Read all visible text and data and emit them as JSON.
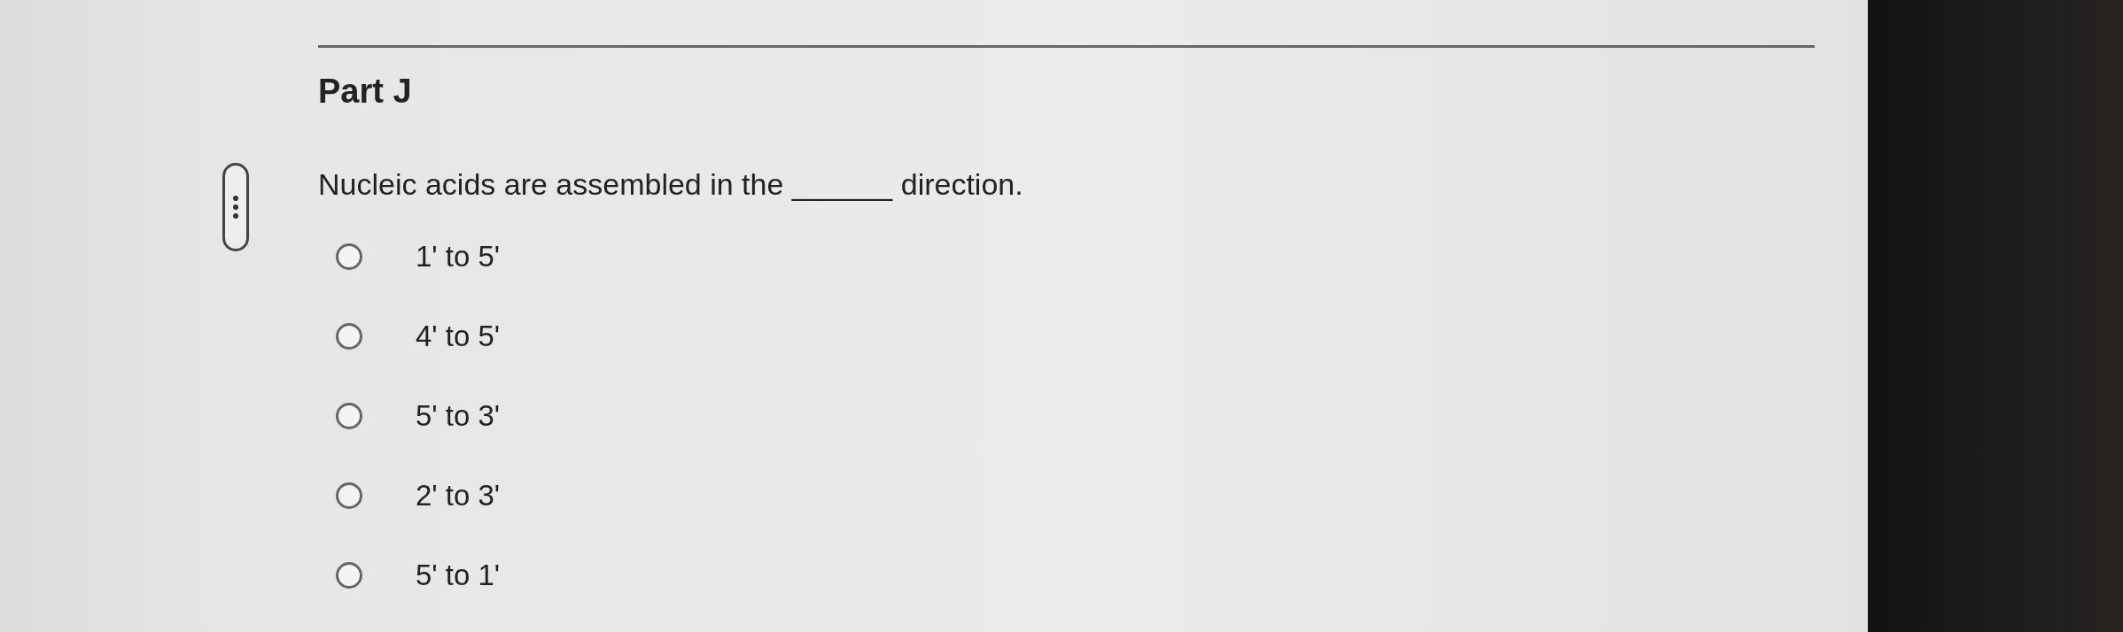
{
  "part_title": "Part J",
  "question": "Nucleic acids are assembled in the ______ direction.",
  "options": [
    {
      "label": "1' to 5'",
      "selected": false
    },
    {
      "label": "4' to 5'",
      "selected": false
    },
    {
      "label": "5' to 3'",
      "selected": false
    },
    {
      "label": "2' to 3'",
      "selected": false
    },
    {
      "label": "5' to 1'",
      "selected": false
    }
  ]
}
